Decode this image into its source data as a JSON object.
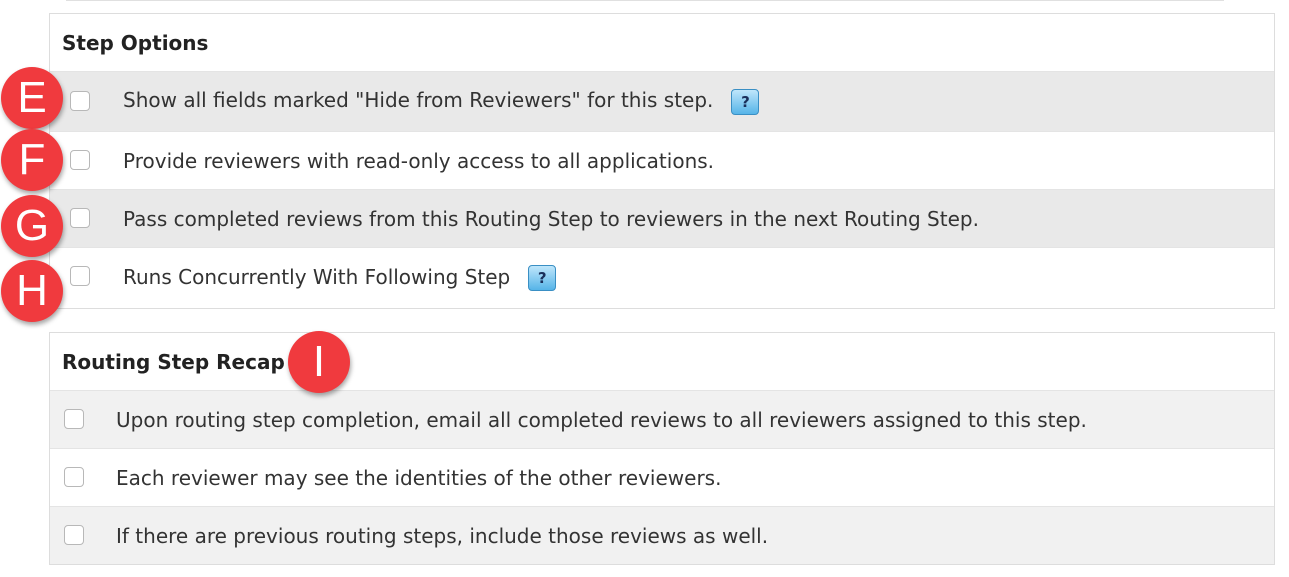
{
  "step_options": {
    "heading": "Step Options",
    "help_icon_glyph": "?",
    "items": [
      {
        "label": "Show all fields marked \"Hide from Reviewers\" for this step.",
        "checked": false,
        "has_help": true
      },
      {
        "label": "Provide reviewers with read-only access to all applications.",
        "checked": false,
        "has_help": false
      },
      {
        "label": "Pass completed reviews from this Routing Step to reviewers in the next Routing Step.",
        "checked": false,
        "has_help": false
      },
      {
        "label": "Runs Concurrently With Following Step",
        "checked": false,
        "has_help": true
      }
    ]
  },
  "routing_step_recap": {
    "heading": "Routing Step Recap",
    "items": [
      {
        "label": "Upon routing step completion, email all completed reviews to all reviewers assigned to this step.",
        "checked": false
      },
      {
        "label": "Each reviewer may see the identities of the other reviewers.",
        "checked": false
      },
      {
        "label": "If there are previous routing steps, include those reviews as well.",
        "checked": false
      }
    ]
  },
  "markers": [
    "E",
    "F",
    "G",
    "H",
    "I"
  ],
  "colors": {
    "marker": "#f03a3e",
    "help_icon": "#56b4e8",
    "row_shaded": "#e9e9e9"
  }
}
